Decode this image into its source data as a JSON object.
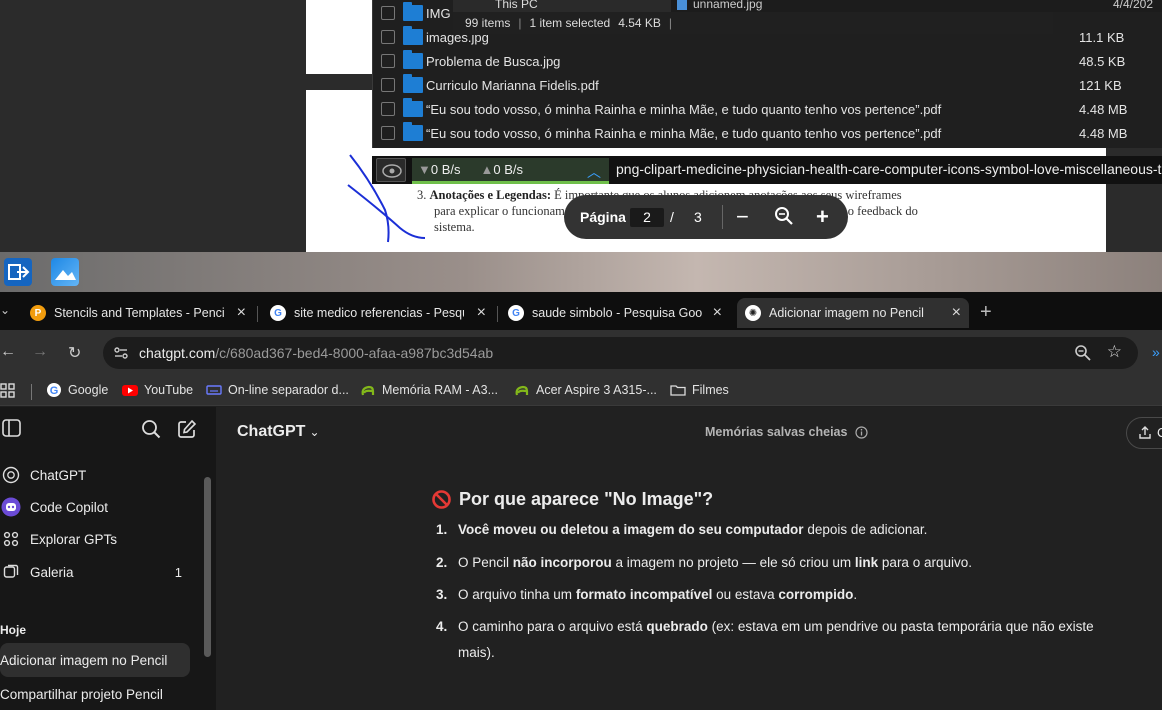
{
  "explorer": {
    "nav_item": "This PC",
    "status_items": "99 items",
    "status_selected": "1 item selected",
    "status_size": "4.54 KB",
    "right_file_name": "unnamed.jpg",
    "right_file_date": "4/4/202",
    "files": [
      {
        "name": "IMG",
        "size": ""
      },
      {
        "name": "images.jpg",
        "size": "11.1 KB"
      },
      {
        "name": "Problema de Busca.jpg",
        "size": "48.5 KB"
      },
      {
        "name": "Curriculo Marianna Fidelis.pdf",
        "size": "121 KB"
      },
      {
        "name": "“Eu sou todo vosso, ó minha Rainha e minha Mãe, e tudo quanto tenho vos pertence”.pdf",
        "size": "4.48 MB"
      },
      {
        "name": "“Eu sou todo vosso, ó minha Rainha e minha Mãe, e tudo quanto tenho vos pertence”.pdf",
        "size": "4.48 MB"
      }
    ]
  },
  "download_bar": {
    "down_speed": "0 B/s",
    "up_speed": "0 B/s",
    "file_name": "png-clipart-medicine-physician-health-care-computer-icons-symbol-love-miscellaneous-t"
  },
  "pdf": {
    "item_number": "3.",
    "item_heading": "Anotações e Legendas:",
    "item_text_line1": "É importante que os alunos adicionem anotações aos seus wireframes",
    "item_text_line2": "para explicar o funcionamento de elementos específicos, interações dos usuários e o feedback do",
    "item_text_line3": "sistema.",
    "toolbar_label": "Página",
    "current_page": "2",
    "separator": "/",
    "total_pages": "3"
  },
  "tabs": [
    {
      "title": "Stencils and Templates - Pencil Project",
      "icon": "pencil-favicon",
      "active": false
    },
    {
      "title": "site medico referencias - Pesquisa Google",
      "icon": "google-favicon",
      "active": false
    },
    {
      "title": "saude simbolo - Pesquisa Google",
      "icon": "google-favicon",
      "active": false
    },
    {
      "title": "Adicionar imagem no Pencil",
      "icon": "chatgpt-favicon",
      "active": true
    }
  ],
  "address": {
    "host": "chatgpt.com",
    "path": "/c/680ad367-bed4-8000-afaa-a987bc3d54ab"
  },
  "bookmarks": [
    {
      "label": "Google",
      "icon": "google-icon"
    },
    {
      "label": "YouTube",
      "icon": "youtube-icon"
    },
    {
      "label": "On-line separador d...",
      "icon": "keyboard-icon"
    },
    {
      "label": "Memória RAM - A3...",
      "icon": "acer-icon"
    },
    {
      "label": "Acer Aspire 3 A315-...",
      "icon": "acer-icon"
    },
    {
      "label": "Filmes",
      "icon": "folder-icon"
    }
  ],
  "sidebar": {
    "items": [
      {
        "label": "ChatGPT",
        "icon": "chatgpt-icon",
        "count": ""
      },
      {
        "label": "Code Copilot",
        "icon": "copilot-icon",
        "count": ""
      },
      {
        "label": "Explorar GPTs",
        "icon": "grid-icon",
        "count": ""
      },
      {
        "label": "Galeria",
        "icon": "gallery-icon",
        "count": "1"
      }
    ],
    "section_label": "Hoje",
    "chats": [
      {
        "label": "Adicionar imagem no Pencil",
        "active": true
      },
      {
        "label": "Compartilhar projeto Pencil",
        "active": false
      }
    ]
  },
  "main": {
    "model_title": "ChatGPT",
    "memory_label": "Memórias salvas cheias",
    "share_label": "C"
  },
  "answer": {
    "heading": "Por que aparece \"No Image\"?",
    "items": [
      {
        "num": "1.",
        "parts": [
          {
            "b": "Você moveu ou deletou a imagem do seu computador"
          },
          {
            "t": " depois de adicionar."
          }
        ]
      },
      {
        "num": "2.",
        "parts": [
          {
            "t": "O Pencil "
          },
          {
            "b": "não incorporou"
          },
          {
            "t": " a imagem no projeto — ele só criou um "
          },
          {
            "b": "link"
          },
          {
            "t": " para o arquivo."
          }
        ]
      },
      {
        "num": "3.",
        "parts": [
          {
            "t": "O arquivo tinha um "
          },
          {
            "b": "formato incompatível"
          },
          {
            "t": " ou estava "
          },
          {
            "b": "corrompido"
          },
          {
            "t": "."
          }
        ]
      },
      {
        "num": "4.",
        "parts": [
          {
            "t": "O caminho para o arquivo está "
          },
          {
            "b": "quebrado"
          },
          {
            "t": " (ex: estava em um pendrive ou pasta temporária que não existe mais)."
          }
        ]
      }
    ]
  }
}
